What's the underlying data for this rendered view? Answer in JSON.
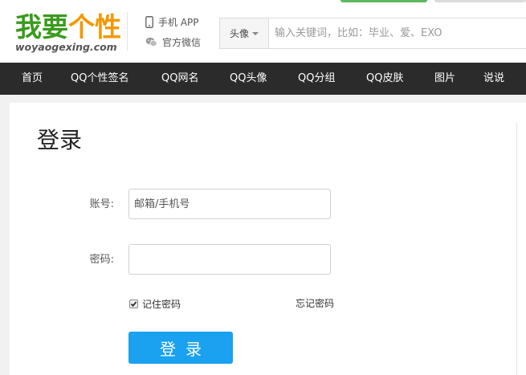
{
  "header": {
    "logo": {
      "text_green": "我要",
      "text_orange": "个性",
      "domain": "woyaogexing.com"
    },
    "app_link": "手机 APP",
    "wechat_link": "官方微信",
    "search": {
      "category": "头像",
      "placeholder": "输入关键词，比如：毕业、爱、EXO"
    }
  },
  "nav": {
    "items": [
      "首页",
      "QQ个性签名",
      "QQ网名",
      "QQ头像",
      "QQ分组",
      "QQ皮肤",
      "图片",
      "说说"
    ]
  },
  "login": {
    "title": "登录",
    "account_label": "账号:",
    "account_placeholder": "邮箱/手机号",
    "password_label": "密码:",
    "remember_label": "记住密码",
    "remember_checked": true,
    "forgot_label": "忘记密码",
    "submit_label": "登录"
  },
  "colors": {
    "nav_bg": "#2b2b2b",
    "button": "#1aa1f0",
    "logo_green": "#3a9b1d",
    "logo_orange": "#f39800"
  },
  "icons": [
    "phone-icon",
    "wechat-icon",
    "chevron-down-icon",
    "checkmark-icon"
  ]
}
